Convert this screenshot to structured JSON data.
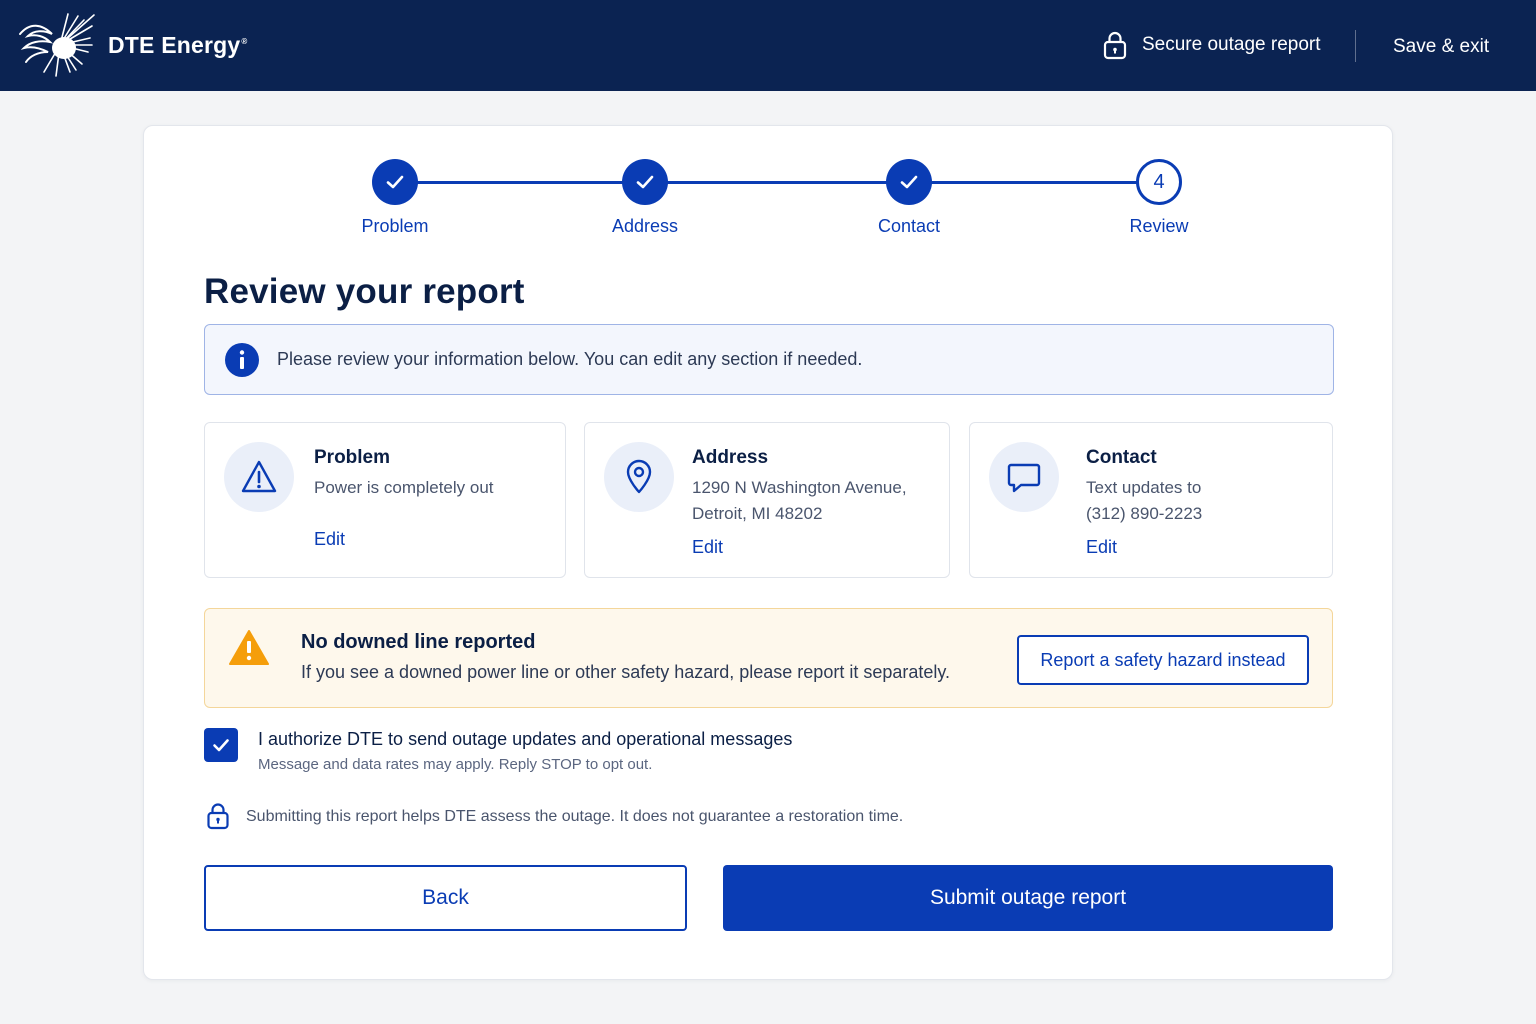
{
  "header": {
    "brand_name": "DTE Energy",
    "brand_mark": "®",
    "secure_label": "Secure outage report",
    "save_exit_label": "Save & exit"
  },
  "stepper": {
    "steps": [
      {
        "label": "Problem",
        "state": "done"
      },
      {
        "label": "Address",
        "state": "done"
      },
      {
        "label": "Contact",
        "state": "done"
      },
      {
        "label": "Review",
        "state": "current",
        "number": "4"
      }
    ]
  },
  "main": {
    "title": "Review your report",
    "info_text": "Please review your information below. You can edit any section if needed."
  },
  "summary": {
    "problem": {
      "title": "Problem",
      "line1": "Power is completely out",
      "edit": "Edit",
      "icon": "warning-triangle-icon"
    },
    "address": {
      "title": "Address",
      "line1": "1290 N Washington Avenue,",
      "line2": "Detroit, MI 48202",
      "edit": "Edit",
      "icon": "map-pin-icon"
    },
    "contact": {
      "title": "Contact",
      "line1": "Text updates to",
      "line2": "(312) 890-2223",
      "edit": "Edit",
      "icon": "chat-bubble-icon"
    }
  },
  "warning": {
    "title": "No downed line reported",
    "body": "If you see a downed power line or other safety hazard, please report it separately.",
    "button": "Report a safety hazard instead"
  },
  "consent": {
    "checked": true,
    "label": "I authorize DTE to send outage updates and operational messages",
    "sub": "Message and data rates may apply. Reply STOP to opt out."
  },
  "note": {
    "text": "Submitting this report helps DTE assess the outage. It does not guarantee a restoration time."
  },
  "actions": {
    "back": "Back",
    "submit": "Submit outage report"
  },
  "colors": {
    "navy": "#0b2352",
    "primary": "#0a3cb4",
    "warning": "#f59e0b"
  }
}
